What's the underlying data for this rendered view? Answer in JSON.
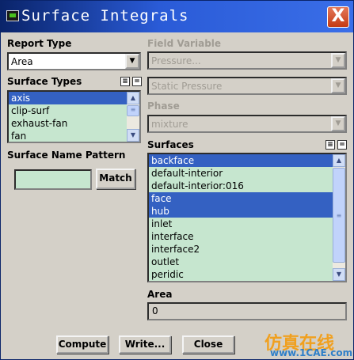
{
  "window": {
    "title": "Surface Integrals",
    "close_glyph": "X"
  },
  "report_type": {
    "label": "Report Type",
    "value": "Area"
  },
  "surface_types": {
    "label": "Surface Types",
    "items": [
      "axis",
      "clip-surf",
      "exhaust-fan",
      "fan"
    ],
    "selected": [
      "axis"
    ]
  },
  "surface_name_pattern": {
    "label": "Surface Name Pattern",
    "value": "",
    "match_label": "Match"
  },
  "field_variable": {
    "label": "Field Variable",
    "category": "Pressure...",
    "quantity": "Static Pressure"
  },
  "phase": {
    "label": "Phase",
    "value": "mixture"
  },
  "surfaces": {
    "label": "Surfaces",
    "items": [
      "backface",
      "default-interior",
      "default-interior:016",
      "face",
      "hub",
      "inlet",
      "interface",
      "interface2",
      "outlet",
      "peridic"
    ],
    "selected": [
      "backface",
      "face",
      "hub"
    ]
  },
  "area": {
    "label": "Area",
    "value": "0"
  },
  "buttons": {
    "compute": "Compute",
    "write": "Write...",
    "close": "Close"
  },
  "icons": {
    "dropdown": "down-arrow-icon",
    "select_all": "select-all-icon",
    "deselect_all": "deselect-all-icon",
    "scroll_up": "scroll-up-icon",
    "scroll_down": "scroll-down-icon"
  },
  "watermark": {
    "main": "仿真在线",
    "site": "www.1CAE.com"
  }
}
